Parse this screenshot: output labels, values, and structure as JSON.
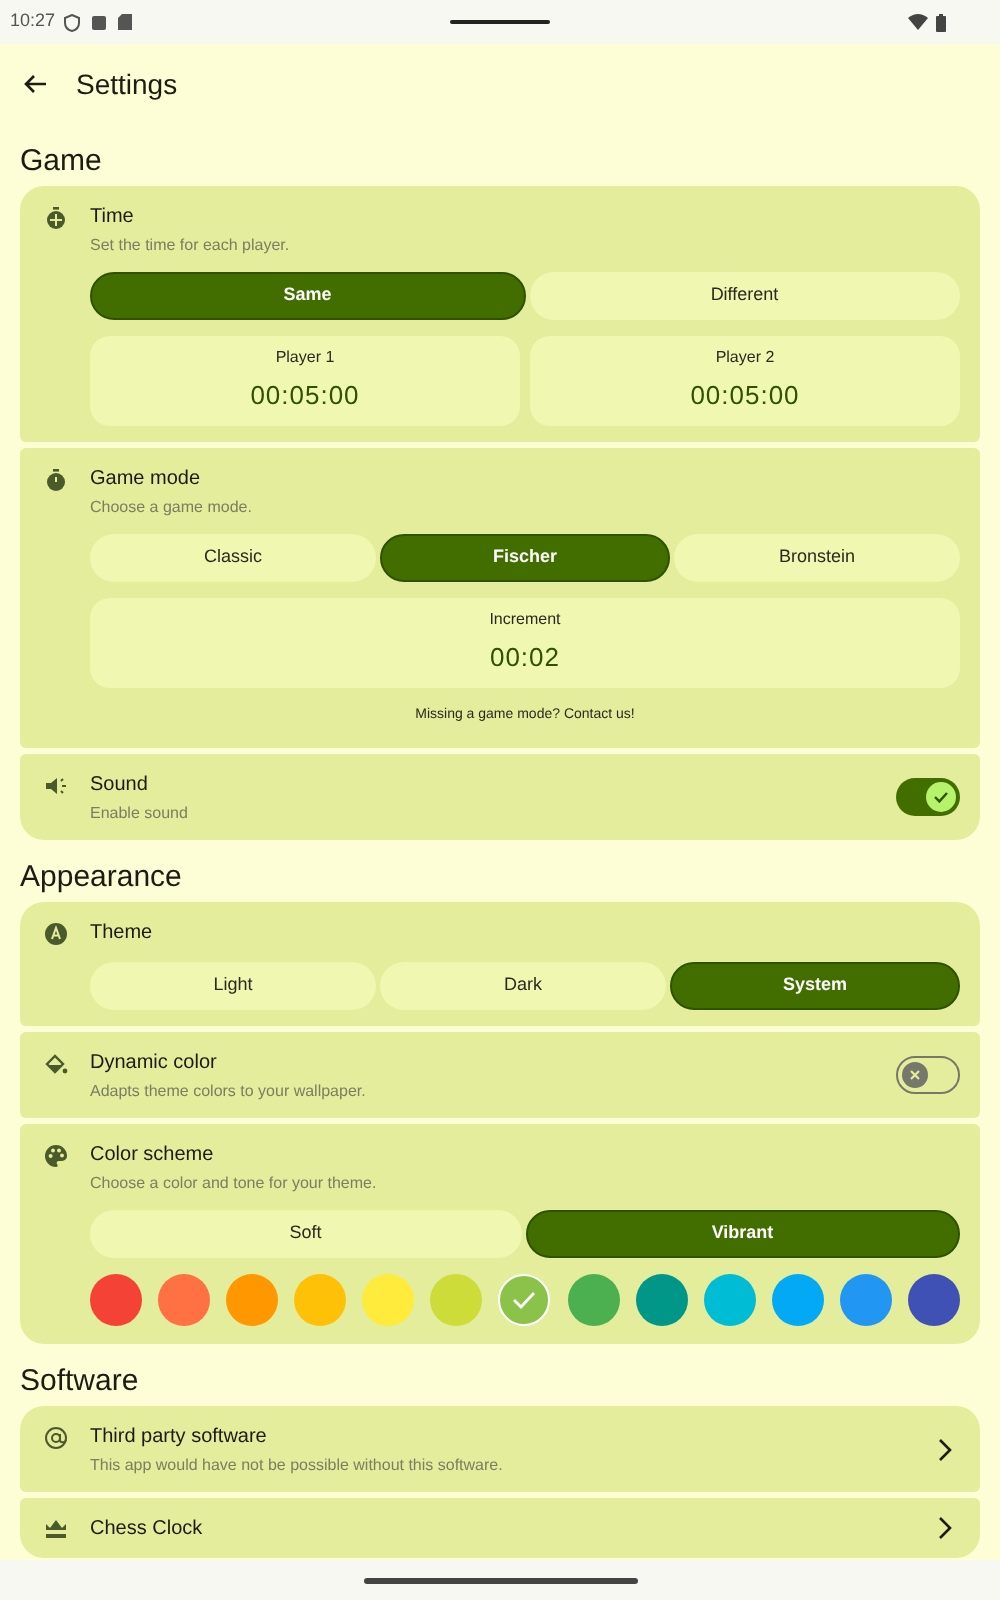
{
  "status_bar": {
    "time": "10:27"
  },
  "app_bar": {
    "title": "Settings"
  },
  "sections": [
    {
      "title": "Game",
      "items": [
        {
          "kind": "time",
          "title": "Time",
          "subtitle": "Set the time for each player.",
          "segments": [
            {
              "label": "Same",
              "selected": true
            },
            {
              "label": "Different",
              "selected": false
            }
          ],
          "tiles": [
            {
              "label": "Player 1",
              "value": "00:05:00"
            },
            {
              "label": "Player 2",
              "value": "00:05:00"
            }
          ]
        },
        {
          "kind": "mode",
          "title": "Game mode",
          "subtitle": "Choose a game mode.",
          "segments": [
            {
              "label": "Classic",
              "selected": false
            },
            {
              "label": "Fischer",
              "selected": true
            },
            {
              "label": "Bronstein",
              "selected": false
            }
          ],
          "tiles": [
            {
              "label": "Increment",
              "value": "00:02"
            }
          ],
          "note": "Missing a game mode? Contact us!"
        },
        {
          "kind": "switch",
          "title": "Sound",
          "subtitle": "Enable sound",
          "on": true
        }
      ]
    },
    {
      "title": "Appearance",
      "items": [
        {
          "kind": "choice",
          "title": "Theme",
          "segments": [
            {
              "label": "Light",
              "selected": false
            },
            {
              "label": "Dark",
              "selected": false
            },
            {
              "label": "System",
              "selected": true
            }
          ]
        },
        {
          "kind": "switch",
          "title": "Dynamic color",
          "subtitle": "Adapts theme colors to your wallpaper.",
          "on": false
        },
        {
          "kind": "scheme",
          "title": "Color scheme",
          "subtitle": "Choose a color and tone for your theme.",
          "segments": [
            {
              "label": "Soft",
              "selected": false
            },
            {
              "label": "Vibrant",
              "selected": true
            }
          ],
          "swatches": [
            {
              "color": "#f44336",
              "selected": false
            },
            {
              "color": "#ff7043",
              "selected": false
            },
            {
              "color": "#ff9800",
              "selected": false
            },
            {
              "color": "#ffc107",
              "selected": false
            },
            {
              "color": "#ffeb3b",
              "selected": false
            },
            {
              "color": "#cddc39",
              "selected": false
            },
            {
              "color": "#8bc34a",
              "selected": true
            },
            {
              "color": "#4caf50",
              "selected": false
            },
            {
              "color": "#009688",
              "selected": false
            },
            {
              "color": "#00bcd4",
              "selected": false
            },
            {
              "color": "#03a9f4",
              "selected": false
            },
            {
              "color": "#2196f3",
              "selected": false
            },
            {
              "color": "#3f51b5",
              "selected": false
            }
          ]
        }
      ]
    },
    {
      "title": "Software",
      "items": [
        {
          "kind": "link",
          "title": "Third party software",
          "subtitle": "This app would have not be possible without this software."
        },
        {
          "kind": "link",
          "title": "Chess Clock"
        }
      ]
    }
  ]
}
